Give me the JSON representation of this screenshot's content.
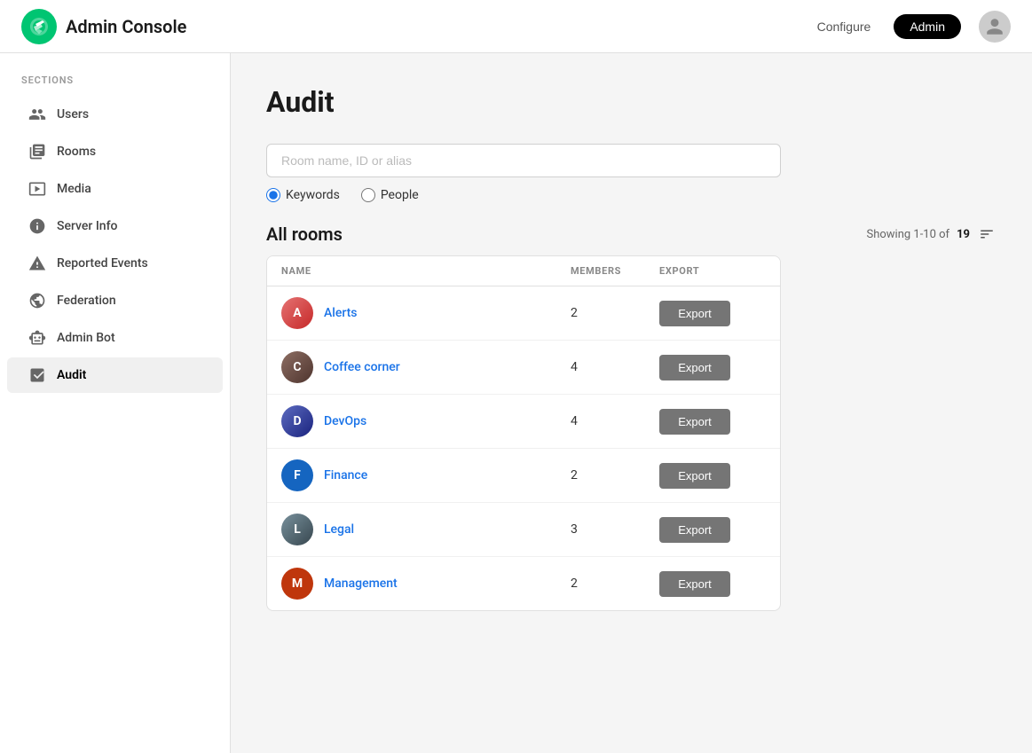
{
  "header": {
    "title": "Admin Console",
    "nav": {
      "configure_label": "Configure",
      "admin_label": "Admin"
    },
    "avatar_alt": "User avatar"
  },
  "sidebar": {
    "sections_label": "SECTIONS",
    "items": [
      {
        "id": "users",
        "label": "Users",
        "icon": "people"
      },
      {
        "id": "rooms",
        "label": "Rooms",
        "icon": "rooms"
      },
      {
        "id": "media",
        "label": "Media",
        "icon": "media"
      },
      {
        "id": "server-info",
        "label": "Server Info",
        "icon": "info"
      },
      {
        "id": "reported-events",
        "label": "Reported Events",
        "icon": "warning"
      },
      {
        "id": "federation",
        "label": "Federation",
        "icon": "globe"
      },
      {
        "id": "admin-bot",
        "label": "Admin Bot",
        "icon": "bot"
      },
      {
        "id": "audit",
        "label": "Audit",
        "icon": "audit",
        "active": true
      }
    ]
  },
  "main": {
    "page_title": "Audit",
    "search_placeholder": "Room name, ID or alias",
    "search_value": "",
    "radio_options": [
      {
        "id": "keywords",
        "label": "Keywords",
        "checked": true
      },
      {
        "id": "people",
        "label": "People",
        "checked": false
      }
    ],
    "all_rooms_label": "All rooms",
    "showing_prefix": "Showing 1-10 of",
    "showing_total": "19",
    "columns": [
      {
        "key": "name",
        "label": "NAME"
      },
      {
        "key": "members",
        "label": "MEMBERS"
      },
      {
        "key": "export",
        "label": "EXPORT"
      }
    ],
    "rooms": [
      {
        "id": "alerts",
        "name": "Alerts",
        "members": 2,
        "avatar_class": "avatar-alerts",
        "avatar_initial": "A"
      },
      {
        "id": "coffee-corner",
        "name": "Coffee corner",
        "members": 4,
        "avatar_class": "avatar-coffee",
        "avatar_initial": "C"
      },
      {
        "id": "devops",
        "name": "DevOps",
        "members": 4,
        "avatar_class": "avatar-devops",
        "avatar_initial": "D"
      },
      {
        "id": "finance",
        "name": "Finance",
        "members": 2,
        "avatar_class": "avatar-finance",
        "avatar_initial": "F"
      },
      {
        "id": "legal",
        "name": "Legal",
        "members": 3,
        "avatar_class": "avatar-legal",
        "avatar_initial": "L"
      },
      {
        "id": "management",
        "name": "Management",
        "members": 2,
        "avatar_class": "avatar-management",
        "avatar_initial": "M"
      }
    ],
    "export_button_label": "Export"
  }
}
